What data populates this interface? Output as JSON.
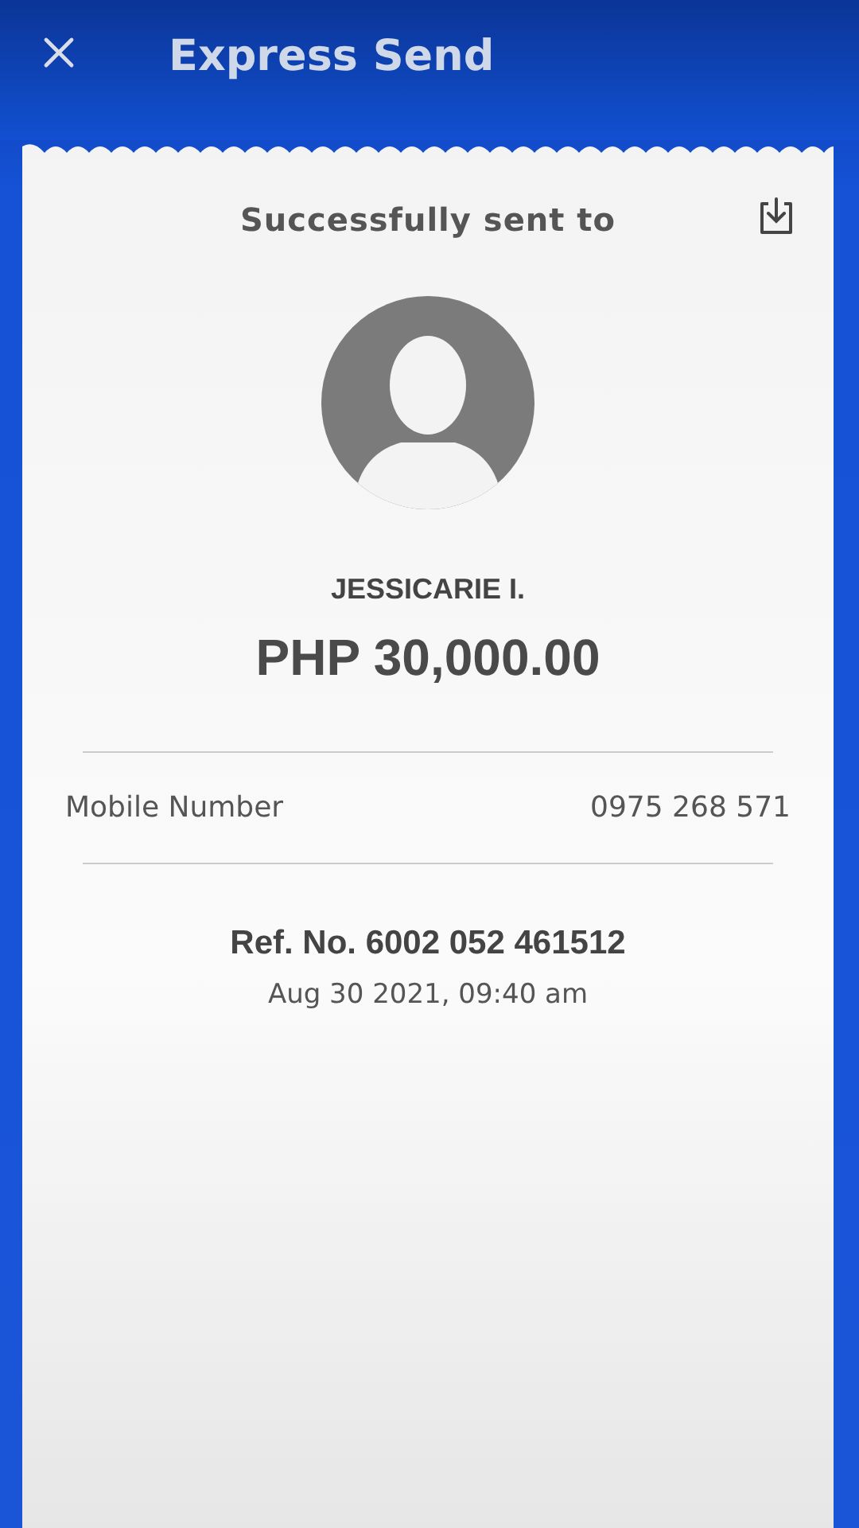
{
  "header": {
    "title": "Express Send"
  },
  "receipt": {
    "heading": "Successfully sent to",
    "recipient_name": "JESSICARIE I.",
    "amount": "PHP 30,000.00",
    "details": [
      {
        "label": "Mobile Number",
        "value": "0975 268 571"
      }
    ],
    "reference": "Ref. No. 6002 052 461512",
    "date": "Aug 30 2021, 09:40 am"
  }
}
